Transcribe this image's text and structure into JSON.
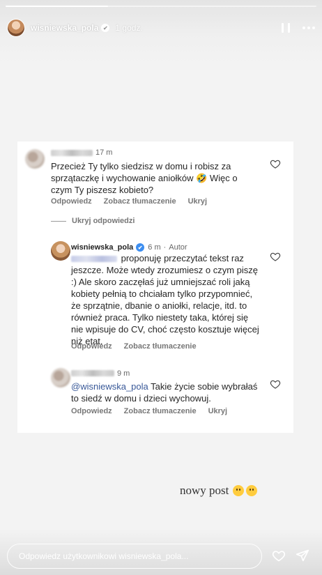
{
  "story": {
    "progress": 0.33,
    "username": "wisniewska_pola",
    "verified_glyph": "✔",
    "time": "1 godz.",
    "pause_icon": "pause-icon",
    "more_icon": "more-icon"
  },
  "screenshot": {
    "comment1": {
      "time": "17 m",
      "text": "Przecież Ty tylko siedzisz w domu i robisz za sprzątaczkę i wychowanie aniołków 🤣 Więc o czym Ty piszesz kobieto?",
      "actions": [
        "Odpowiedz",
        "Zobacz tłumaczenie",
        "Ukryj"
      ]
    },
    "hide_replies": "Ukryj odpowiedzi",
    "reply1": {
      "username": "wisniewska_pola",
      "verified_glyph": "✔",
      "time": "6 m",
      "role": "Autor",
      "text": "proponuję przeczytać tekst raz jeszcze. Może wtedy zrozumiesz o czym piszę :) Ale skoro zaczęłaś już umniejszać roli jaką kobiety pełnią to chciałam tylko przypomnieć, że sprzątnie, dbanie o aniołki, relacje, itd. to również praca. Tylko niestety taka, której się nie wpisuje do CV, choć często kosztuje więcej niż etat.",
      "actions": [
        "Odpowiedz",
        "Zobacz tłumaczenie"
      ]
    },
    "reply2": {
      "time": "9 m",
      "mention": "@wisniewska_pola",
      "text": "Takie życie sobie wybrałaś to siedź w domu i dzieci wychowuj.",
      "actions": [
        "Odpowiedz",
        "Zobacz tłumaczenie",
        "Ukryj"
      ]
    }
  },
  "caption": "nowy post",
  "emoji": [
    "face-with-hand-over-mouth",
    "grinning-face"
  ],
  "reply_placeholder": "Odpowiedz użytkownikowi wisniewska_pola...",
  "colors": {
    "verified": "#3d8ef0",
    "mention": "#385898"
  }
}
